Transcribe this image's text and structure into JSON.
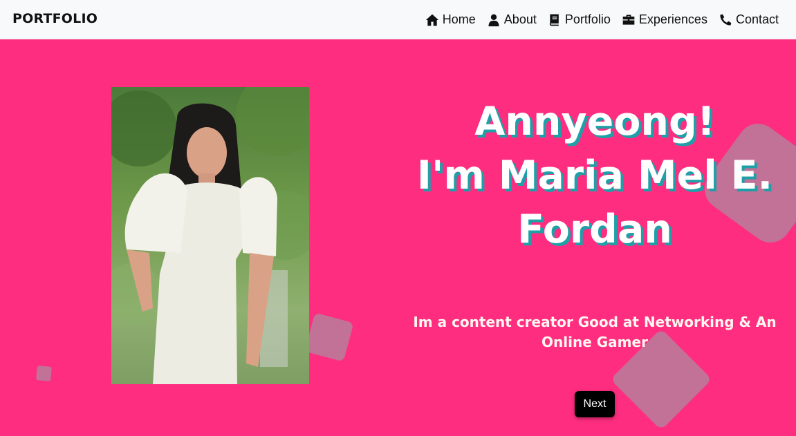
{
  "navbar": {
    "brand": "PORTFOLIO",
    "links": [
      {
        "label": "Home",
        "icon": "home-icon"
      },
      {
        "label": "About",
        "icon": "user-icon"
      },
      {
        "label": "Portfolio",
        "icon": "book-icon"
      },
      {
        "label": "Experiences",
        "icon": "briefcase-icon"
      },
      {
        "label": "Contact",
        "icon": "phone-icon"
      }
    ]
  },
  "hero": {
    "greeting_line1": "Annyeong!",
    "greeting_line2": "I'm Maria Mel E.",
    "greeting_line3": "Fordan",
    "tagline": "Im a content creator Good at Networking & An Online Gamer",
    "next_label": "Next"
  },
  "colors": {
    "hero_background": "#ff2d80",
    "heading_shadow": "#1fa0a8",
    "navbar_background": "#f8f9fa",
    "button_background": "#000000"
  }
}
